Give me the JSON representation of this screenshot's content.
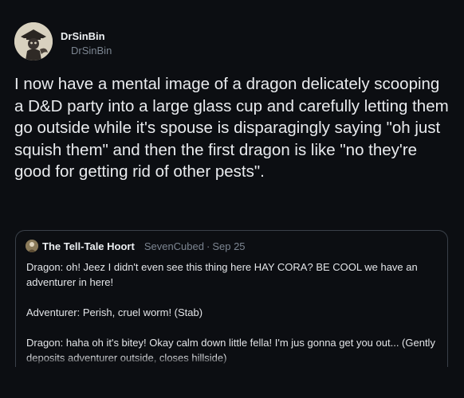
{
  "post": {
    "display_name": "DrSinBin",
    "handle": "DrSinBin",
    "avatar_icon": "avatar",
    "text": "I now have a mental image of a dragon delicately scooping a D&D party into a large glass cup and carefully letting them go outside while it's spouse is disparagingly saying \"oh just squish them\" and then the first dragon is like \"no they're good for getting rid of other pests\"."
  },
  "quote": {
    "display_name": "The Tell-Tale Hoort",
    "handle": "SevenCubed",
    "separator": "·",
    "date": "Sep 25",
    "lines": [
      "Dragon: oh! Jeez I didn't even see this thing here HAY CORA? BE COOL we have an adventurer in here!",
      "Adventurer: Perish, cruel worm! (Stab)",
      "Dragon: haha oh it's bitey! Okay calm down little fella! I'm jus gonna get you out... (Gently deposits adventurer outside, closes hillside)"
    ]
  },
  "colors": {
    "background": "#0c0e12",
    "text_primary": "#e9ebee",
    "text_secondary": "#7c8591",
    "card_border": "#3a4049"
  }
}
